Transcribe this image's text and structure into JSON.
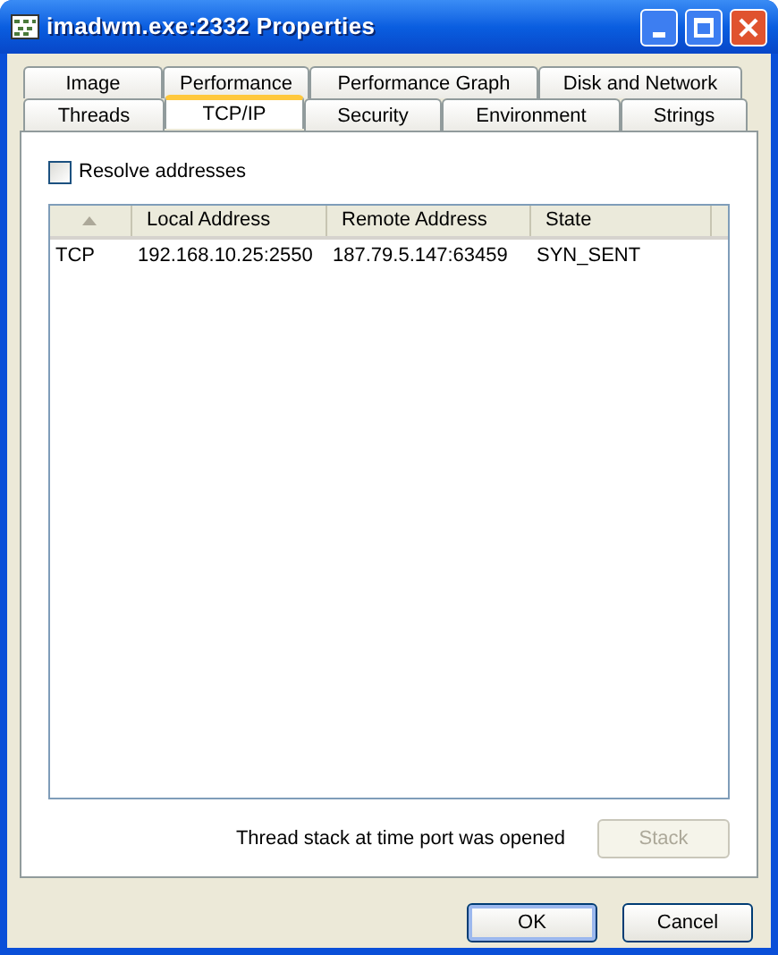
{
  "window": {
    "title": "imadwm.exe:2332 Properties"
  },
  "tabs": [
    [
      {
        "label": "Image",
        "selected": false
      },
      {
        "label": "Performance",
        "selected": false
      },
      {
        "label": "Performance Graph",
        "selected": false
      },
      {
        "label": "Disk and Network",
        "selected": false
      }
    ],
    [
      {
        "label": "Threads",
        "selected": false
      },
      {
        "label": "TCP/IP",
        "selected": true
      },
      {
        "label": "Security",
        "selected": false
      },
      {
        "label": "Environment",
        "selected": false
      },
      {
        "label": "Strings",
        "selected": false
      }
    ]
  ],
  "resolve_addresses": {
    "label": "Resolve addresses",
    "checked": false
  },
  "table": {
    "columns": [
      {
        "sorted": true
      },
      {
        "label": "Local Address",
        "sorted": false
      },
      {
        "label": "Remote Address",
        "sorted": false
      },
      {
        "label": "State",
        "sorted": false
      }
    ],
    "rows": [
      [
        "TCP",
        "192.168.10.25:2550",
        "187.79.5.147:63459",
        "SYN_SENT"
      ]
    ]
  },
  "stack_caption": "Thread stack at time port was opened",
  "stack_button": {
    "label": "Stack",
    "disabled": true
  },
  "buttons": [
    {
      "label": "OK",
      "default": true
    },
    {
      "label": "Cancel",
      "default": false
    }
  ]
}
